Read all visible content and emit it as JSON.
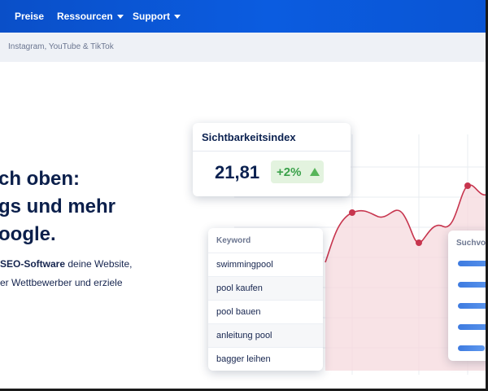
{
  "nav": {
    "items": [
      {
        "label": "Preise",
        "dropdown": false
      },
      {
        "label": "Ressourcen",
        "dropdown": true
      },
      {
        "label": "Support",
        "dropdown": true
      }
    ]
  },
  "subbar": {
    "text": "Instagram, YouTube & TikTok"
  },
  "hero": {
    "line1": "ch oben:",
    "line2": "gs und mehr",
    "line3": "oogle.",
    "desc1_bold": "SEO-Software",
    "desc1_rest": " deine Website,",
    "desc2": "er Wettbewerber und erziele"
  },
  "visibility_card": {
    "title": "Sichtbarkeitsindex",
    "value": "21,81",
    "delta": "+2%"
  },
  "keyword_card": {
    "header": "Keyword",
    "keywords": [
      "swimmingpool",
      "pool kaufen",
      "pool bauen",
      "anleitung pool",
      "bagger leihen"
    ]
  },
  "volume_card": {
    "header": "Suchvolu",
    "bar_fractions": [
      0.9,
      0.8,
      0.72,
      0.85,
      0.55
    ]
  },
  "colors": {
    "nav_blue": "#0b5ce0",
    "line_red": "#c7354e",
    "area_pink": "#f5dadd",
    "positive_green": "#3aa14a",
    "bar_blue": "#3e7be0"
  }
}
